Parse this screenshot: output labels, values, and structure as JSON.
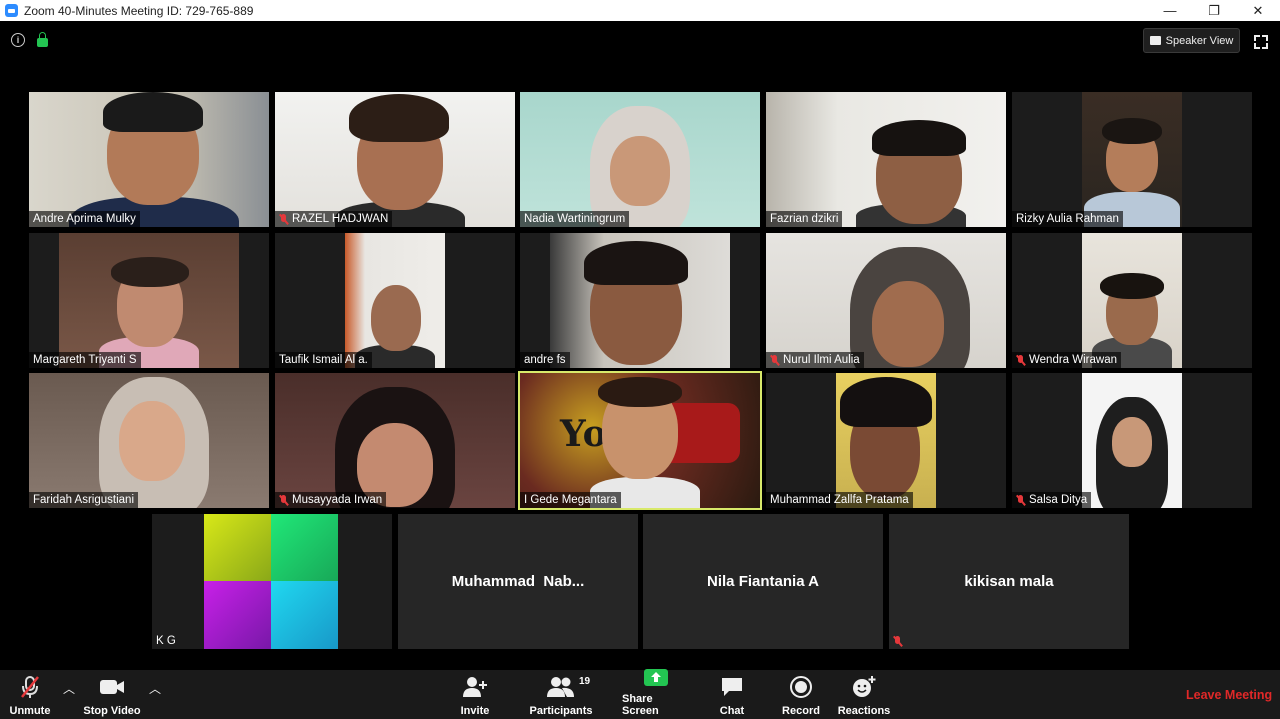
{
  "window": {
    "title": "Zoom 40-Minutes Meeting ID: 729-765-889",
    "minimize": "—",
    "restore": "❐",
    "close": "✕"
  },
  "header": {
    "speaker_view": "Speaker View"
  },
  "participants": [
    {
      "name": "Andre Aprima Mulky",
      "muted": false
    },
    {
      "name": "RAZEL HADJWAN",
      "muted": true
    },
    {
      "name": "Nadia Wartiningrum",
      "muted": false
    },
    {
      "name": "Fazrian dzikri",
      "muted": false
    },
    {
      "name": "Rizky Aulia Rahman",
      "muted": false
    },
    {
      "name": "Margareth Triyanti S",
      "muted": false
    },
    {
      "name": "Taufik Ismail Al a.",
      "muted": false
    },
    {
      "name": "andre fs",
      "muted": false
    },
    {
      "name": "Nurul Ilmi Aulia",
      "muted": true
    },
    {
      "name": "Wendra Wirawan",
      "muted": true
    },
    {
      "name": "Faridah Asrigustiani",
      "muted": false
    },
    {
      "name": "Musayyada Irwan",
      "muted": true
    },
    {
      "name": "I Gede Megantara",
      "muted": false,
      "active_speaker": true
    },
    {
      "name": "Muhammad Zallfa Pratama",
      "muted": false
    },
    {
      "name": "Salsa Ditya",
      "muted": true
    },
    {
      "name": "K G",
      "muted": false
    },
    {
      "name": "Muhammad  Nab...",
      "muted": false,
      "video_off": true
    },
    {
      "name": "Nila Fiantania A",
      "muted": false,
      "video_off": true
    },
    {
      "name": "kikisan mala",
      "muted": true,
      "video_off": true
    }
  ],
  "toolbar": {
    "unmute": "Unmute",
    "stop_video": "Stop Video",
    "invite": "Invite",
    "participants": "Participants",
    "participants_count": "19",
    "share_screen": "Share Screen",
    "chat": "Chat",
    "record": "Record",
    "reactions": "Reactions",
    "leave": "Leave Meeting"
  },
  "colors": {
    "leave": "#e02828",
    "share": "#23c552",
    "active_border": "#d8e96a",
    "muted": "#e5383b"
  }
}
